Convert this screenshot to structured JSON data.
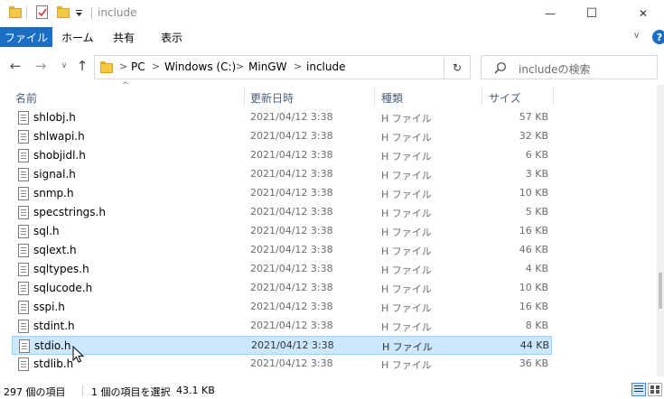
{
  "window": {
    "title": "include",
    "minimize_glyph": "—",
    "maximize_glyph": "☐",
    "close_glyph": "✕"
  },
  "ribbon": {
    "file_tab": "ファイル",
    "tabs": [
      "ホーム",
      "共有",
      "表示"
    ],
    "help": "?",
    "expand": "∨"
  },
  "nav": {
    "back": "←",
    "forward": "→",
    "recent": "∨",
    "up": "↑",
    "breadcrumbs": [
      "PC",
      "Windows (C:)",
      "MinGW",
      "include"
    ],
    "crumb_separator": ">",
    "refresh": "↻",
    "search_placeholder": "includeの検索"
  },
  "columns": {
    "name": "名前",
    "date": "更新日時",
    "type": "種類",
    "size": "サイズ",
    "sort_indicator": "^"
  },
  "files": [
    {
      "name": "shlobj.h",
      "date": "2021/04/12 3:38",
      "type": "H ファイル",
      "size": "57 KB",
      "selected": false
    },
    {
      "name": "shlwapi.h",
      "date": "2021/04/12 3:38",
      "type": "H ファイル",
      "size": "32 KB",
      "selected": false
    },
    {
      "name": "shobjidl.h",
      "date": "2021/04/12 3:38",
      "type": "H ファイル",
      "size": "6 KB",
      "selected": false
    },
    {
      "name": "signal.h",
      "date": "2021/04/12 3:38",
      "type": "H ファイル",
      "size": "3 KB",
      "selected": false
    },
    {
      "name": "snmp.h",
      "date": "2021/04/12 3:38",
      "type": "H ファイル",
      "size": "10 KB",
      "selected": false
    },
    {
      "name": "specstrings.h",
      "date": "2021/04/12 3:38",
      "type": "H ファイル",
      "size": "5 KB",
      "selected": false
    },
    {
      "name": "sql.h",
      "date": "2021/04/12 3:38",
      "type": "H ファイル",
      "size": "16 KB",
      "selected": false
    },
    {
      "name": "sqlext.h",
      "date": "2021/04/12 3:38",
      "type": "H ファイル",
      "size": "46 KB",
      "selected": false
    },
    {
      "name": "sqltypes.h",
      "date": "2021/04/12 3:38",
      "type": "H ファイル",
      "size": "4 KB",
      "selected": false
    },
    {
      "name": "sqlucode.h",
      "date": "2021/04/12 3:38",
      "type": "H ファイル",
      "size": "10 KB",
      "selected": false
    },
    {
      "name": "sspi.h",
      "date": "2021/04/12 3:38",
      "type": "H ファイル",
      "size": "16 KB",
      "selected": false
    },
    {
      "name": "stdint.h",
      "date": "2021/04/12 3:38",
      "type": "H ファイル",
      "size": "8 KB",
      "selected": false
    },
    {
      "name": "stdio.h",
      "date": "2021/04/12 3:38",
      "type": "H ファイル",
      "size": "44 KB",
      "selected": true
    },
    {
      "name": "stdlib.h",
      "date": "2021/04/12 3:38",
      "type": "H ファイル",
      "size": "36 KB",
      "selected": false
    }
  ],
  "status": {
    "item_count": "297 個の項目",
    "selection": "1 個の項目を選択",
    "selection_size": "43.1 KB"
  },
  "colors": {
    "accent": "#1a6fc4",
    "selection_bg": "#cce8ff",
    "selection_border": "#99d1ff",
    "folder": "#f5c843"
  }
}
